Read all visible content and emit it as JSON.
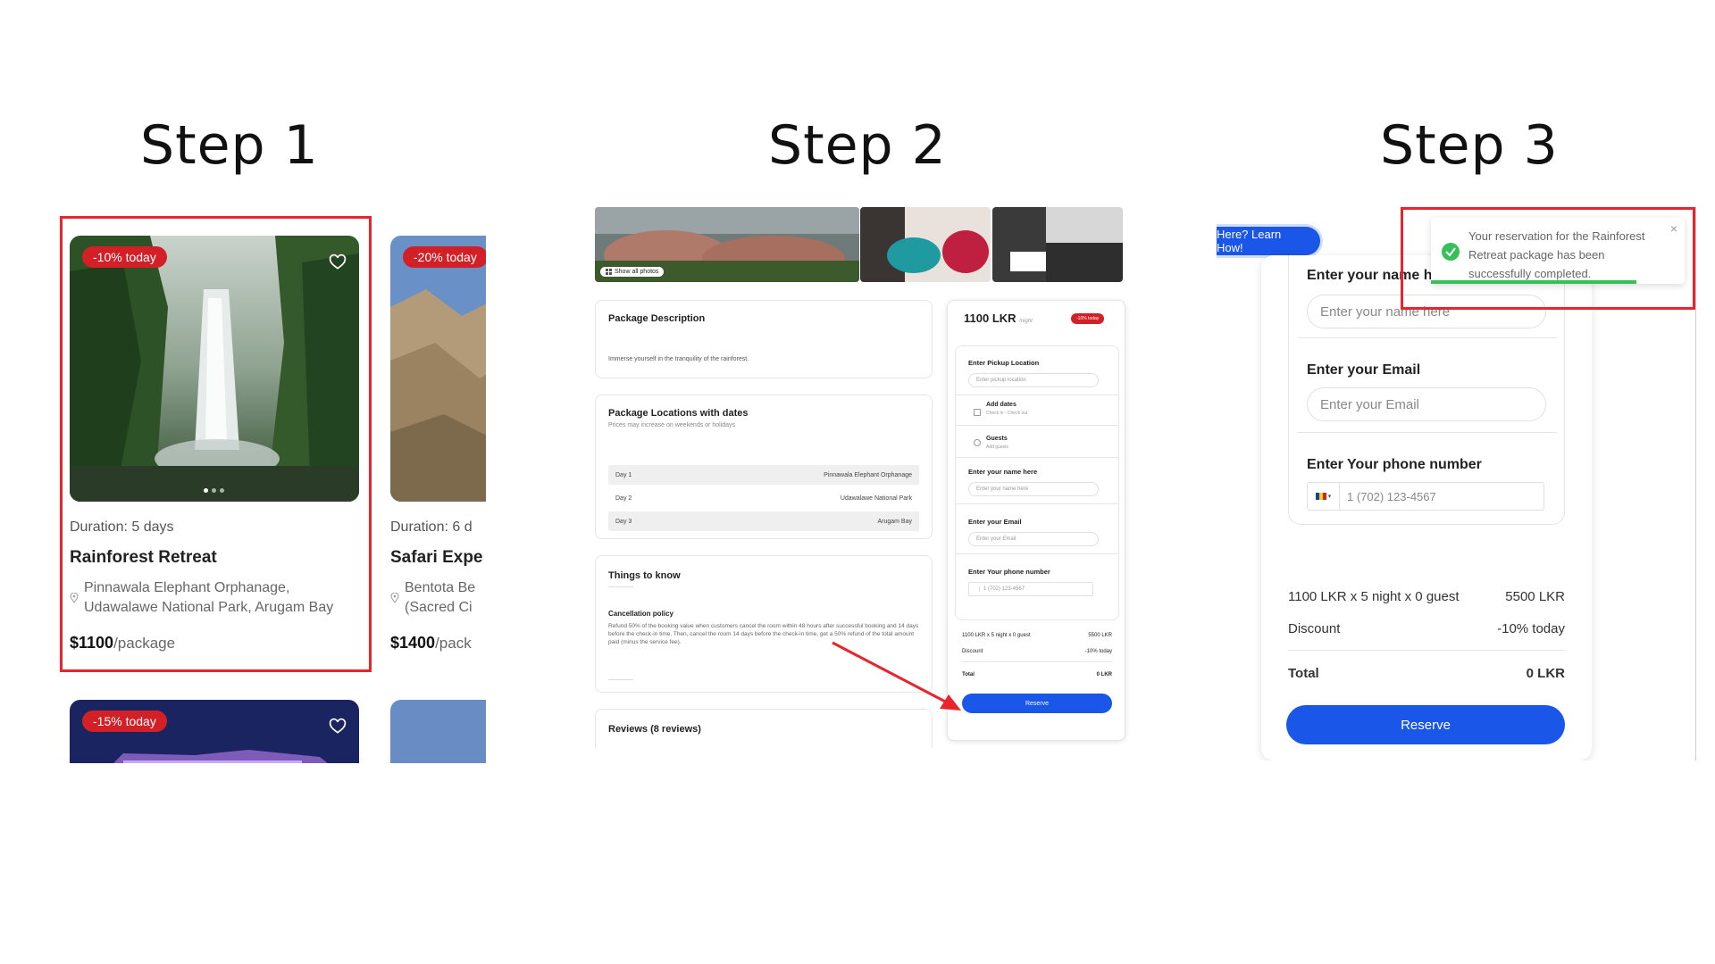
{
  "steps": {
    "step1": "Step 1",
    "step2": "Step 2",
    "step3": "Step 3"
  },
  "step1": {
    "cards": [
      {
        "badge": "-10% today",
        "duration": "Duration: 5 days",
        "title": "Rainforest Retreat",
        "location": "Pinnawala Elephant Orphanage, Udawalawe National Park, Arugam Bay",
        "price": "$1100",
        "price_unit": "/package"
      },
      {
        "badge": "-20% today",
        "duration": "Duration: 6 d",
        "title": "Safari Expe",
        "location": "Bentota Be (Sacred Ci",
        "price": "$1400",
        "price_unit": "/pack"
      },
      {
        "badge": "-15% today"
      }
    ]
  },
  "step2": {
    "show_all_photos": "Show all photos",
    "description": {
      "title": "Package Description",
      "text": "Immerse yourself in the tranquility of the rainforest."
    },
    "locations": {
      "title": "Package Locations with dates",
      "subtitle": "Prices may increase on weekends or holidays",
      "days": [
        {
          "day": "Day 1",
          "place": "Pinnawala Elephant Orphanage"
        },
        {
          "day": "Day 2",
          "place": "Udawalawe National Park"
        },
        {
          "day": "Day 3",
          "place": "Arugam Bay"
        }
      ]
    },
    "things": {
      "title": "Things to know",
      "policy_title": "Cancellation policy",
      "policy_text": "Refund 50% of the booking value when customers cancel the room within 48 hours after successful booking and 14 days before the check-in time. Then, cancel the room 14 days before the check-in time, get a 50% refund of the total amount paid (minus the service fee)."
    },
    "reviews": "Reviews (8 reviews)",
    "sidebar": {
      "price": "1100 LKR",
      "per": "/night",
      "badge": "-10% today",
      "pickup_label": "Enter Pickup Location",
      "pickup_placeholder": "Enter pickup location",
      "add_dates": "Add dates",
      "check": "Check in - Check out",
      "guests": "Guests",
      "add_guests": "Add guests",
      "name_label": "Enter your name here",
      "name_placeholder": "Enter your name here",
      "email_label": "Enter your Email",
      "email_placeholder": "Enter your Email",
      "phone_label": "Enter Your phone number",
      "phone_placeholder": "1 (702) 123-4567",
      "calc": "1100 LKR x 5 night x 0 guest",
      "calc_value": "5500 LKR",
      "discount": "Discount",
      "discount_value": "-10% today",
      "total": "Total",
      "total_value": "0 LKR",
      "reserve": "Reserve"
    }
  },
  "step3": {
    "learn_how": "Here? Learn How!",
    "toast": "Your reservation for the Rainforest Retreat package has been successfully completed.",
    "name_label": "Enter your name here",
    "name_placeholder": "Enter your name here",
    "email_label": "Enter your Email",
    "email_placeholder": "Enter your Email",
    "phone_label": "Enter Your phone number",
    "phone_placeholder": "1 (702) 123-4567",
    "calc": "1100 LKR x 5 night x 0 guest",
    "calc_value": "5500 LKR",
    "discount": "Discount",
    "discount_value": "-10% today",
    "total": "Total",
    "total_value": "0 LKR",
    "reserve": "Reserve"
  },
  "colors": {
    "accent": "#1a56e8",
    "badge": "#d32027",
    "highlight": "#e8242c",
    "success": "#37c05a"
  }
}
